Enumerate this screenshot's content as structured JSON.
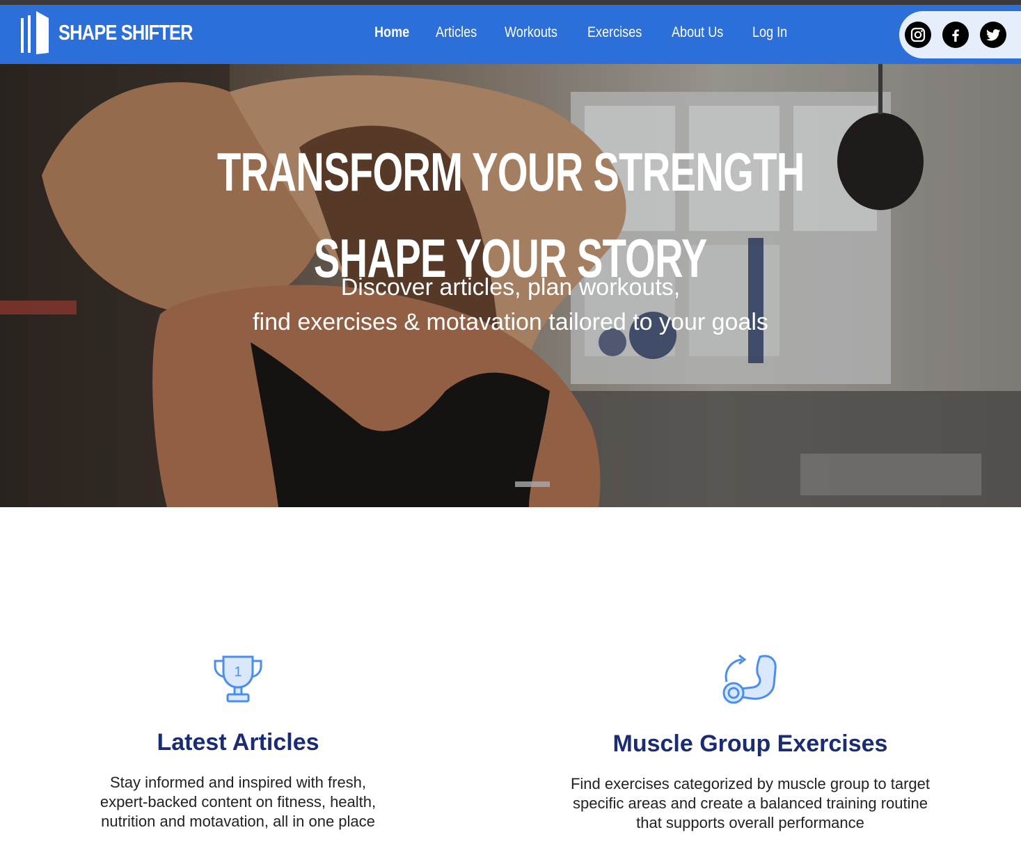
{
  "brand": {
    "name": "SHAPE SHIFTER"
  },
  "nav": {
    "items": [
      {
        "label": "Home",
        "active": true
      },
      {
        "label": "Articles",
        "active": false
      },
      {
        "label": "Workouts",
        "active": false
      },
      {
        "label": "Exercises",
        "active": false
      },
      {
        "label": "About Us",
        "active": false
      },
      {
        "label": "Log In",
        "active": false
      }
    ],
    "social": [
      "instagram-icon",
      "facebook-icon",
      "twitter-icon"
    ]
  },
  "hero": {
    "title_line1": "TRANSFORM YOUR STRENGTH",
    "title_line2": "SHAPE YOUR STORY",
    "subtitle_line1": "Discover articles, plan workouts,",
    "subtitle_line2": "find exercises & motavation tailored to your goals"
  },
  "features": [
    {
      "icon": "trophy-icon",
      "trophy_number": "1",
      "title": "Latest Articles",
      "desc_lines": [
        "Stay informed and inspired with fresh,",
        "expert-backed content on fitness, health,",
        "nutrition and motavation, all in one place"
      ]
    },
    {
      "icon": "flexed-arm-icon",
      "title": "Muscle Group Exercises",
      "desc_lines": [
        "Find exercises categorized by muscle group to target",
        "specific areas and create a balanced training routine",
        "that supports overall performance"
      ]
    }
  ],
  "colors": {
    "nav_bg": "#2c6fd8",
    "heading": "#1a2c74",
    "icon_blue": "#4a8ef0",
    "social_pill": "#e6eefb"
  }
}
